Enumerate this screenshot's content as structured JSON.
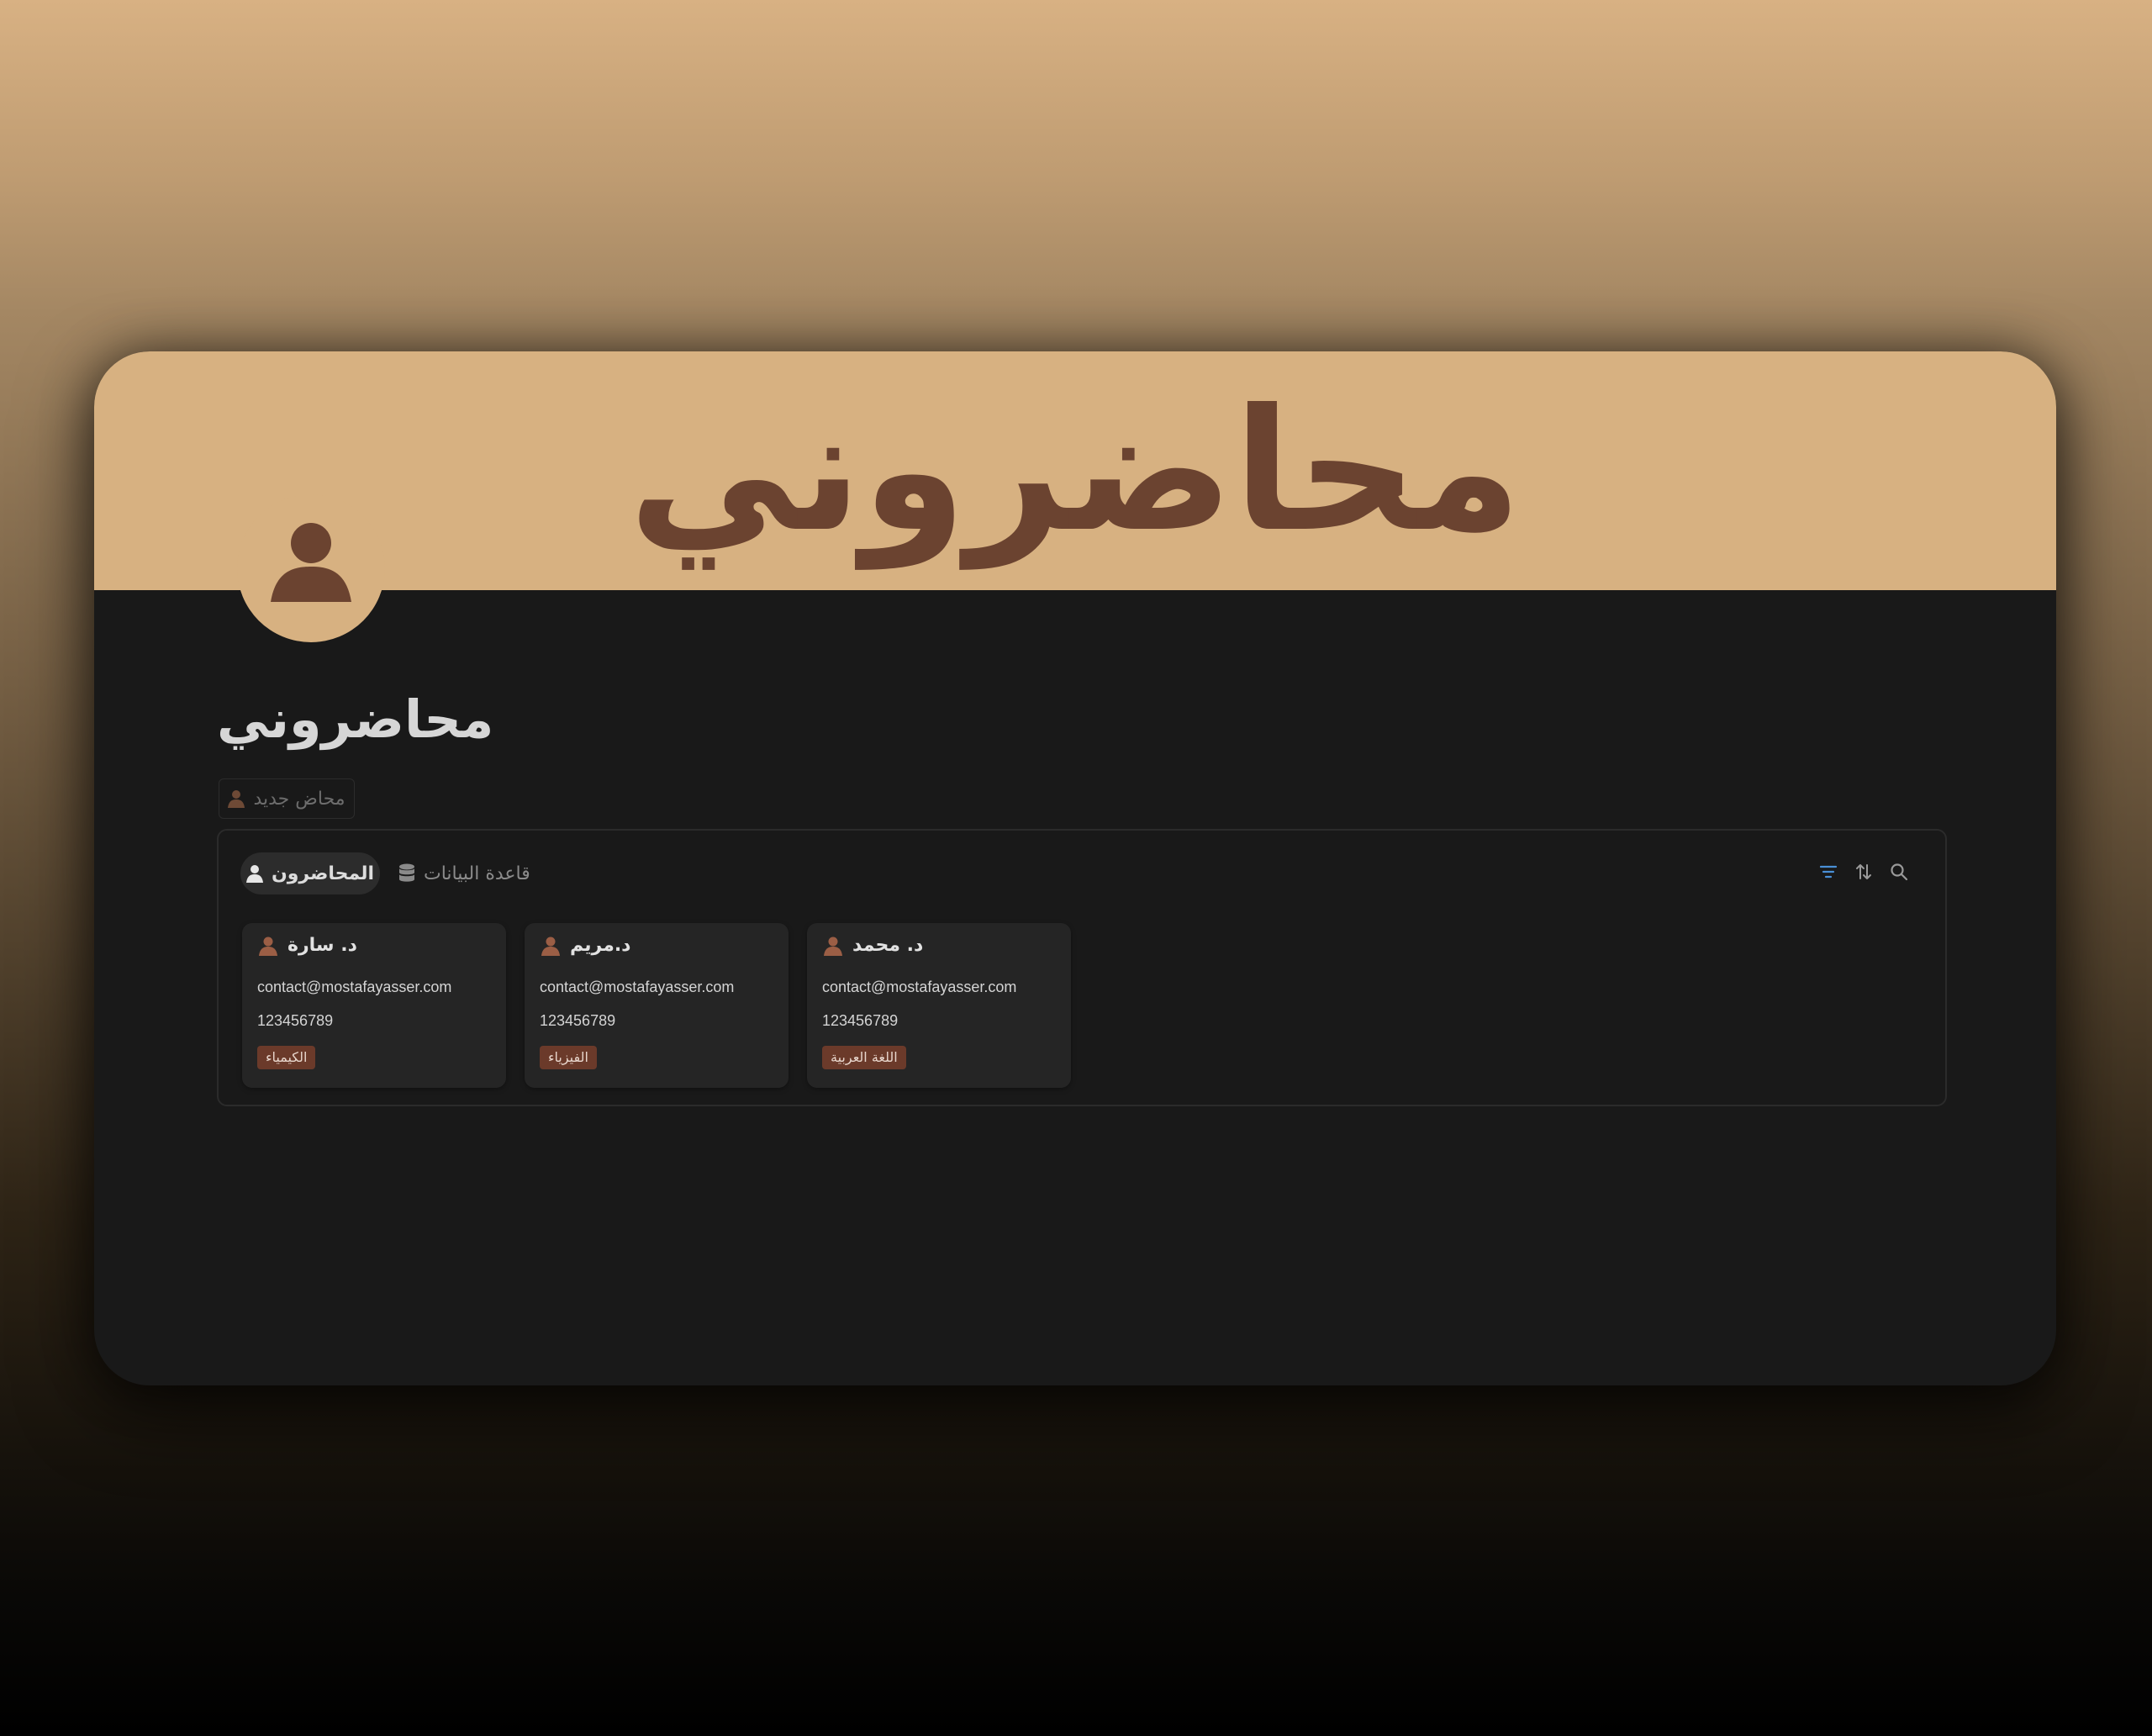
{
  "cover": {
    "title": "محاضروني"
  },
  "page": {
    "title": "محاضروني",
    "icon": "person-icon"
  },
  "toolbar": {
    "new_button_label": "محاض جديد"
  },
  "database": {
    "tabs": [
      {
        "label": "المحاضرون",
        "icon": "person-icon",
        "active": true
      },
      {
        "label": "قاعدة البيانات",
        "icon": "database-icon",
        "active": false
      }
    ],
    "tools": [
      "filter-icon",
      "sort-icon",
      "search-icon"
    ],
    "cards": [
      {
        "name": "د. سارة",
        "email": "contact@mostafayasser.com",
        "phone": "123456789",
        "tag": "الكيمياء"
      },
      {
        "name": "د.مريم",
        "email": "contact@mostafayasser.com",
        "phone": "123456789",
        "tag": "الفيزياء"
      },
      {
        "name": "د. محمد",
        "email": "contact@mostafayasser.com",
        "phone": "123456789",
        "tag": "اللغة العربية"
      }
    ]
  },
  "colors": {
    "accent": "#d7b181",
    "brown": "#6b4330",
    "tag_bg": "#6b3a2a",
    "background": "#191919",
    "filter_icon": "#4a8fd6"
  }
}
